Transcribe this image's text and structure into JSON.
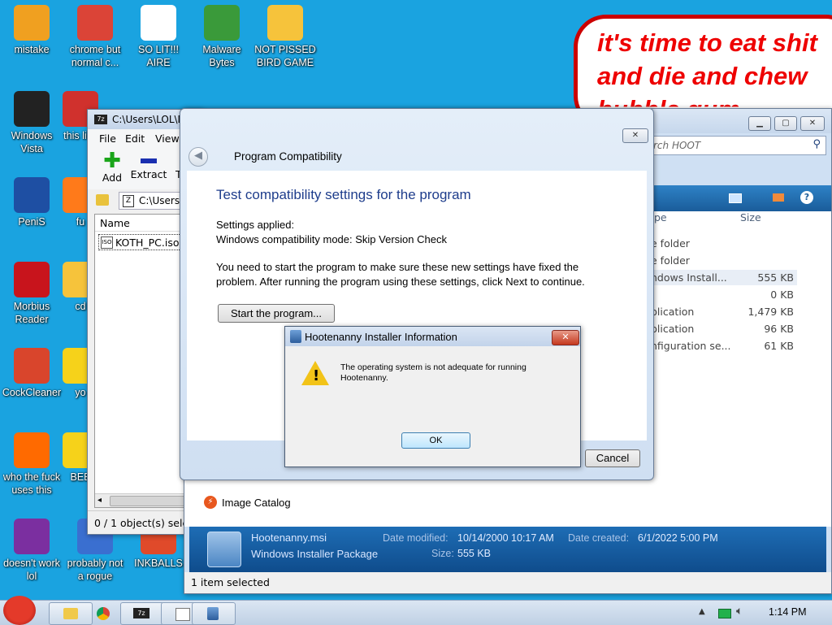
{
  "desktop": {
    "icons": [
      {
        "label": "mistake",
        "color": "#f0a020"
      },
      {
        "label": "chrome but normal c...",
        "color": "#db4437"
      },
      {
        "label": "SO LIT!!! AIRE",
        "color": "#ffffff"
      },
      {
        "label": "Malware Bytes",
        "color": "#3a9a3a"
      },
      {
        "label": "NOT PISSED BIRD GAME",
        "color": "#f6c33b"
      },
      {
        "label": "Windows Vista",
        "color": "#222222"
      },
      {
        "label": "this like",
        "color": "#d0312d"
      },
      {
        "label": "PeniS",
        "color": "#1e4fa3"
      },
      {
        "label": "fu",
        "color": "#ff7a1a"
      },
      {
        "label": "Morbius Reader",
        "color": "#c8141c"
      },
      {
        "label": "cd",
        "color": "#f6c33b"
      },
      {
        "label": "CockCleaner",
        "color": "#d9452c"
      },
      {
        "label": "yo",
        "color": "#f6d21a"
      },
      {
        "label": "who the fuck uses this",
        "color": "#ff6a00"
      },
      {
        "label": "BEE",
        "color": "#f6d21a"
      },
      {
        "label": "doesn't work lol",
        "color": "#7b2fa0"
      },
      {
        "label": "probably not a rogue",
        "color": "#3a6fd0"
      },
      {
        "label": "INKBALLS",
        "color": "#e04a2a"
      }
    ],
    "bubble_lines": [
      "it's time to eat shit",
      "and die and chew",
      "bubble gum"
    ]
  },
  "sevenzip": {
    "title": "C:\\Users\\LOL\\D",
    "menu": [
      "File",
      "Edit",
      "View"
    ],
    "toolbar": {
      "add": "Add",
      "extract": "Extract",
      "test": "T"
    },
    "path": "C:\\Users",
    "column_name": "Name",
    "file": "KOTH_PC.iso",
    "status": "0 / 1 object(s) sele"
  },
  "explorer": {
    "search_placeholder": "rch HOOT",
    "col_type": "pe",
    "col_size": "Size",
    "rows": [
      {
        "type": "e folder",
        "size": ""
      },
      {
        "type": "e folder",
        "size": ""
      },
      {
        "type": "ndows Install...",
        "size": "555 KB"
      },
      {
        "type": "",
        "size": "0 KB"
      },
      {
        "type": "plication",
        "size": "1,479 KB"
      },
      {
        "type": "plication",
        "size": "96 KB"
      },
      {
        "type": "nfiguration se...",
        "size": "61 KB"
      }
    ],
    "nav_item": "Image Catalog",
    "details": {
      "name": "Hootenanny.msi",
      "kind": "Windows Installer Package",
      "modified_label": "Date modified:",
      "modified": "10/14/2000 10:17 AM",
      "created_label": "Date created:",
      "created": "6/1/2022 5:00 PM",
      "size_label": "Size:",
      "size": "555 KB"
    },
    "status": "1 item selected"
  },
  "compat": {
    "title": "Program Compatibility",
    "heading": "Test compatibility settings for the program",
    "applied_label": "Settings applied:",
    "applied_value": "Windows compatibility mode: Skip Version Check",
    "instructions": "You need to start the program to make sure these new settings have fixed the problem. After running the program using these settings, click Next to continue.",
    "start_button": "Start the program...",
    "cancel_button": "Cancel"
  },
  "msgbox": {
    "title": "Hootenanny Installer Information",
    "message": "The operating system is not adequate for running Hootenanny.",
    "ok": "OK"
  },
  "taskbar": {
    "time": "1:14 PM"
  }
}
